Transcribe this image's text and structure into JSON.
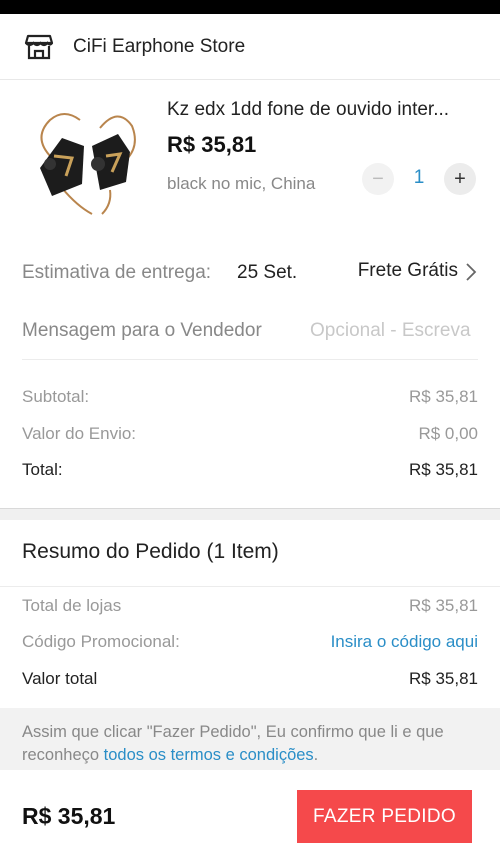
{
  "store": {
    "name": "CiFi Earphone Store",
    "icon": "store-icon"
  },
  "product": {
    "title": "Kz edx 1dd fone de ouvido inter...",
    "price": "R$ 35,81",
    "variant": "black no mic, China",
    "quantity": "1",
    "minus_label": "−",
    "plus_label": "+"
  },
  "delivery": {
    "label": "Estimativa de entrega:",
    "date": "25 Set.",
    "shipping": "Frete Grátis"
  },
  "message": {
    "label": "Mensagem para o Vendedor",
    "placeholder": "Opcional - Escreva"
  },
  "order_totals": {
    "subtotal_label": "Subtotal:",
    "subtotal_value": "R$ 35,81",
    "shipping_label": "Valor do Envio:",
    "shipping_value": "R$ 0,00",
    "total_label": "Total:",
    "total_value": "R$ 35,81"
  },
  "summary": {
    "title": "Resumo do Pedido (1 Item)",
    "stores_label": "Total de lojas",
    "stores_value": "R$ 35,81",
    "promo_label": "Código Promocional:",
    "promo_link": "Insira o código aqui",
    "total_label": "Valor total",
    "total_value": "R$ 35,81"
  },
  "terms": {
    "text_part1": "Assim que clicar \"Fazer Pedido\", Eu confirmo que li e que reconheço ",
    "link": "todos os termos e condições",
    "text_part2": "."
  },
  "footer": {
    "price": "R$ 35,81",
    "button_label": "FAZER PEDIDO"
  },
  "colors": {
    "accent": "#f5494b",
    "link": "#2a8ec7"
  }
}
